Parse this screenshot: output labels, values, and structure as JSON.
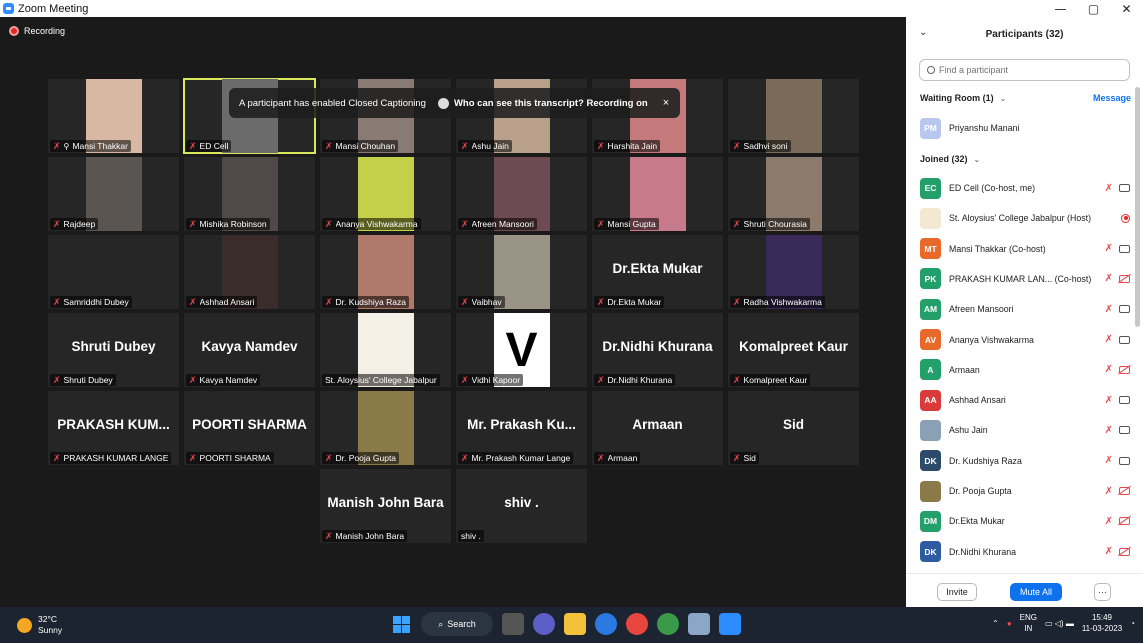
{
  "window": {
    "title": "Zoom Meeting",
    "min": "—",
    "max": "▢",
    "close": "✕"
  },
  "recording": {
    "label": "Recording"
  },
  "banner": {
    "message": "A participant has enabled Closed Captioning",
    "question": "Who can see this transcript? Recording on",
    "close": "×"
  },
  "tiles": [
    {
      "name": "Mansi Thakkar",
      "pin": true,
      "photo": "#d9b8a3"
    },
    {
      "name": "ED Cell",
      "photo": "#6b6b6b",
      "active": true
    },
    {
      "name": "Mansi Chouhan",
      "photo": "#8a7a74"
    },
    {
      "name": "Ashu Jain",
      "photo": "#b8a08a"
    },
    {
      "name": "Harshita Jain",
      "photo": "#c47a7a"
    },
    {
      "name": "Sadhvi soni",
      "photo": "#7a6a5a"
    },
    {
      "name": "Rajdeep",
      "photo": "#5a5550"
    },
    {
      "name": "Mishika Robinson",
      "photo": "#4f4a47"
    },
    {
      "name": "Ananya Vishwakarma",
      "photo": "#c5d04a"
    },
    {
      "name": "Afreen Mansoori",
      "photo": "#6e4b52"
    },
    {
      "name": "Mansi Gupta",
      "photo": "#c77b8a"
    },
    {
      "name": "Shruti Chourasia",
      "photo": "#8c7b6c"
    },
    {
      "name": "Samriddhi Dubey",
      "big": ""
    },
    {
      "name": "Ashhad Ansari",
      "photo": "#3b2c2c"
    },
    {
      "name": "Dr. Kudshiya Raza",
      "photo": "#b07a6a"
    },
    {
      "name": "Vaibhav",
      "photo": "#9a9486"
    },
    {
      "name": "Dr.Ekta Mukar",
      "big": "Dr.Ekta Mukar"
    },
    {
      "name": "Radha Vishwakarma",
      "photo": "#3a2a5a"
    },
    {
      "name": "Shruti Dubey",
      "big": "Shruti Dubey"
    },
    {
      "name": "Kavya Namdev",
      "big": "Kavya Namdev"
    },
    {
      "name": "St. Aloysius' College Jabalpur",
      "photo": "#f5f0e6",
      "nomute": true
    },
    {
      "name": "Vidhi Kapoor",
      "photo": "#ffffff",
      "letter": "V"
    },
    {
      "name": "Dr.Nidhi Khurana",
      "big": "Dr.Nidhi Khurana"
    },
    {
      "name": "Komalpreet Kaur",
      "big": "Komalpreet Kaur"
    },
    {
      "name": "PRAKASH KUMAR LANGE",
      "big": "PRAKASH KUM..."
    },
    {
      "name": "POORTI SHARMA",
      "big": "POORTI SHARMA"
    },
    {
      "name": "Dr. Pooja Gupta",
      "photo": "#8a7a4a"
    },
    {
      "name": "Mr. Prakash Kumar Lange",
      "big": "Mr. Prakash Ku..."
    },
    {
      "name": "Armaan",
      "big": "Armaan"
    },
    {
      "name": "Sid",
      "big": "Sid"
    },
    {
      "name": "Manish John Bara",
      "big": "Manish John Bara"
    },
    {
      "name": "shiv .",
      "big": "shiv .",
      "nomute": true
    }
  ],
  "panel": {
    "title": "Participants (32)",
    "search_placeholder": "Find a participant",
    "waiting_room": "Waiting Room (1)",
    "message": "Message",
    "waiting": {
      "initials": "PM",
      "name": "Priyanshu Manani",
      "color": "#b9c7f0"
    },
    "joined": "Joined (32)",
    "participants": [
      {
        "initials": "EC",
        "name": "ED Cell (Co-host, me)",
        "color": "#23a06a",
        "cam": "on"
      },
      {
        "initials": "",
        "name": "St. Aloysius' College Jabalpur (Host)",
        "color": "#f3e9d2",
        "cam": "rec",
        "logo": true
      },
      {
        "initials": "MT",
        "name": "Mansi Thakkar (Co-host)",
        "color": "#e8692a",
        "cam": "on"
      },
      {
        "initials": "PK",
        "name": "PRAKASH KUMAR LAN... (Co-host)",
        "color": "#23a06a",
        "cam": "off"
      },
      {
        "initials": "AM",
        "name": "Afreen Mansoori",
        "color": "#23a06a",
        "cam": "on"
      },
      {
        "initials": "AV",
        "name": "Ananya Vishwakarma",
        "color": "#e8692a",
        "cam": "on"
      },
      {
        "initials": "A",
        "name": "Armaan",
        "color": "#23a06a",
        "cam": "off"
      },
      {
        "initials": "AA",
        "name": "Ashhad Ansari",
        "color": "#d93a3a",
        "cam": "on"
      },
      {
        "initials": "",
        "name": "Ashu Jain",
        "color": "#8aa0b4",
        "cam": "on",
        "photo": true
      },
      {
        "initials": "DK",
        "name": "Dr. Kudshiya Raza",
        "color": "#2d4a6b",
        "cam": "on"
      },
      {
        "initials": "",
        "name": "Dr. Pooja Gupta",
        "color": "#8a7a4a",
        "cam": "off",
        "photo": true
      },
      {
        "initials": "DM",
        "name": "Dr.Ekta Mukar",
        "color": "#23a06a",
        "cam": "off"
      },
      {
        "initials": "DK",
        "name": "Dr.Nidhi Khurana",
        "color": "#2d5aa0",
        "cam": "off"
      }
    ],
    "invite": "Invite",
    "mute_all": "Mute All",
    "more": "···"
  },
  "taskbar": {
    "temp": "32°C",
    "condition": "Sunny",
    "search": "Search",
    "lang1": "ENG",
    "lang2": "IN",
    "time": "15:49",
    "date": "11-03-2023"
  }
}
